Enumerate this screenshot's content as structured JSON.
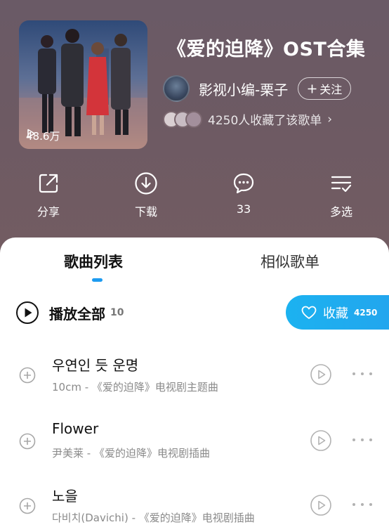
{
  "playlist": {
    "title": "《爱的迫降》OST合集",
    "play_count": "48.6万",
    "creator": "影视小编-栗子",
    "follow_label": "关注",
    "collect_text": "4250人收藏了该歌单"
  },
  "actions": {
    "share_label": "分享",
    "download_label": "下载",
    "comment_label": "33",
    "multiselect_label": "多选"
  },
  "tabs": [
    {
      "label": "歌曲列表"
    },
    {
      "label": "相似歌单"
    }
  ],
  "list": {
    "play_all_label": "播放全部",
    "song_count": "10",
    "favorite_label": "收藏",
    "favorite_count": "4250"
  },
  "songs": [
    {
      "title": "우연인 듯 운명",
      "artist_desc": "10cm - 《爱的迫降》电视剧主题曲"
    },
    {
      "title": "Flower",
      "artist_desc": "尹美莱 - 《爱的迫降》电视剧插曲"
    },
    {
      "title": "노을",
      "artist_desc": "다비치(Davichi) - 《爱的迫降》电视剧插曲"
    }
  ],
  "colors": {
    "header_bg": "#6d5a63",
    "accent": "#1e9bf0",
    "favorite_button": "#1cb2f0"
  }
}
